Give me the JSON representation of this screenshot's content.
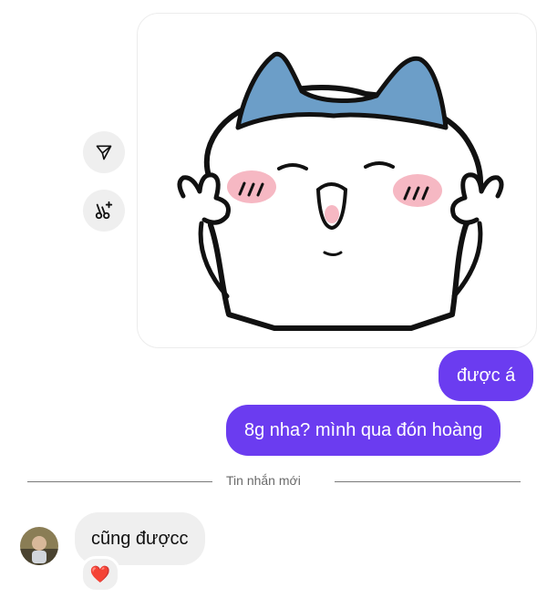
{
  "thread": {
    "sticker": {
      "icon": "cat-sticker-icon"
    },
    "actions": {
      "share_icon": "send-icon",
      "remix_icon": "scissors-sparkle-icon"
    },
    "messages_out": [
      {
        "text": "được á"
      },
      {
        "text": "8g nha? mình qua đón hoàng"
      }
    ],
    "divider": {
      "label": "Tin nhắn mới"
    },
    "message_in": {
      "text": "cũng đượcc",
      "reaction": "❤️",
      "avatar_icon": "avatar-icon"
    }
  },
  "colors": {
    "outgoing_bubble": "#6b3cf0",
    "incoming_bubble": "#efefef",
    "sticker_bow": "#6c9ec8",
    "sticker_blush": "#f6b8c3"
  }
}
